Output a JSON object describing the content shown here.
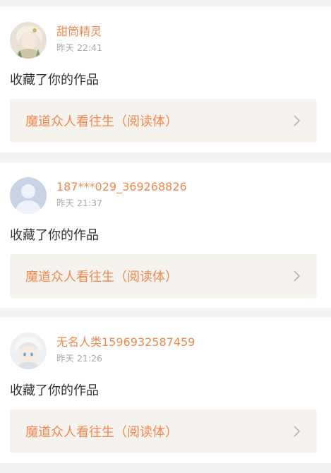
{
  "notifications": [
    {
      "username": "甜筒精灵",
      "time": "昨天 22:41",
      "action": "收藏了你的作品",
      "work_title": "魔道众人看往生（阅读体）",
      "avatar_icon": "anime-avatar-light-hair"
    },
    {
      "username": "187***029_369268826",
      "time": "昨天 21:37",
      "action": "收藏了你的作品",
      "work_title": "魔道众人看往生（阅读体）",
      "avatar_icon": "default-user-avatar"
    },
    {
      "username": "无名人类1596932587459",
      "time": "昨天 21:26",
      "action": "收藏了你的作品",
      "work_title": "魔道众人看往生（阅读体）",
      "avatar_icon": "anime-avatar-white-hair"
    }
  ],
  "colors": {
    "accent": "#f0884f",
    "work_card_bg": "#f6f3ee",
    "page_bg": "#f3f3f3"
  }
}
